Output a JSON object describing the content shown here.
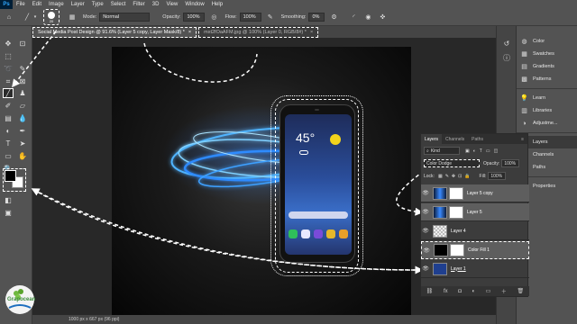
{
  "menu": [
    "File",
    "Edit",
    "Image",
    "Layer",
    "Type",
    "Select",
    "Filter",
    "3D",
    "View",
    "Window",
    "Help"
  ],
  "options": {
    "brush_size": "20",
    "mode_label": "Mode:",
    "mode_value": "Normal",
    "opacity_label": "Opacity:",
    "opacity_value": "100%",
    "flow_label": "Flow:",
    "flow_value": "100%",
    "smoothing_label": "Smoothing:",
    "smoothing_value": "0%"
  },
  "tabs": [
    "Social Media Post Design @ 91.6% (Layer 5 copy, Layer Mask/8) *",
    "mxt2fOaAFM.jpg @ 100% (Layer 0, RGB/8#) *"
  ],
  "status": "1000 px x 667 px (96 ppi)",
  "phone": {
    "temperature": "45°"
  },
  "right_panels": [
    {
      "label": "Color",
      "icon": "color-wheel-icon"
    },
    {
      "label": "Swatches",
      "icon": "swatches-icon"
    },
    {
      "label": "Gradients",
      "icon": "gradient-icon"
    },
    {
      "label": "Patterns",
      "icon": "pattern-icon"
    },
    {
      "label": "Learn",
      "icon": "bulb-icon"
    },
    {
      "label": "Libraries",
      "icon": "library-icon"
    },
    {
      "label": "Adjustme...",
      "icon": "adjustments-icon"
    },
    {
      "label": "Layers",
      "icon": "layers-icon"
    },
    {
      "label": "Channels",
      "icon": "channels-icon"
    },
    {
      "label": "Paths",
      "icon": "paths-icon"
    },
    {
      "label": "Properties",
      "icon": "properties-icon"
    }
  ],
  "layers_panel": {
    "tabs": [
      "Layers",
      "Channels",
      "Paths"
    ],
    "kind": "Kind",
    "blend_mode": "Color Dodge",
    "opacity_label": "Opacity:",
    "opacity_value": "100%",
    "lock_label": "Lock:",
    "fill_label": "Fill:",
    "fill_value": "100%",
    "layers": [
      "Layer 5 copy",
      "Layer 5",
      "Layer 4",
      "Color Fill 1",
      "Layer 1"
    ]
  },
  "logo_text": "Grapocean"
}
